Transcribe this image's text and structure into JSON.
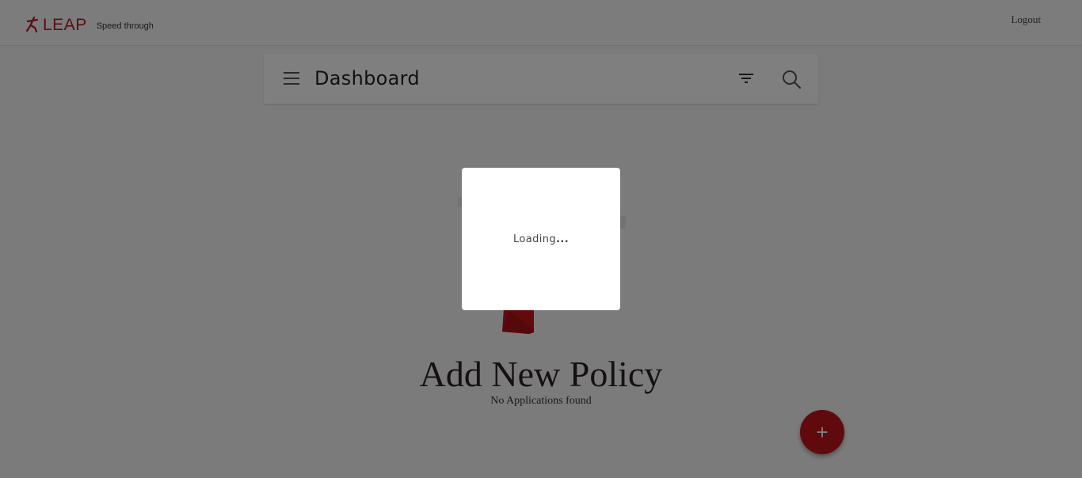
{
  "header": {
    "brand_name": "LEAP",
    "tagline": "Speed through",
    "logout_label": "Logout",
    "brand_color": "#b81c22"
  },
  "dashboard": {
    "title": "Dashboard",
    "menu_icon": "hamburger-menu-icon",
    "filter_icon": "filter-icon",
    "search_icon": "search-icon"
  },
  "empty_state": {
    "title": "Add New Policy",
    "subtitle": "No Applications found"
  },
  "fab": {
    "label": "+",
    "color": "#c0141d"
  },
  "loader": {
    "text": "Loading",
    "dots": "..."
  }
}
